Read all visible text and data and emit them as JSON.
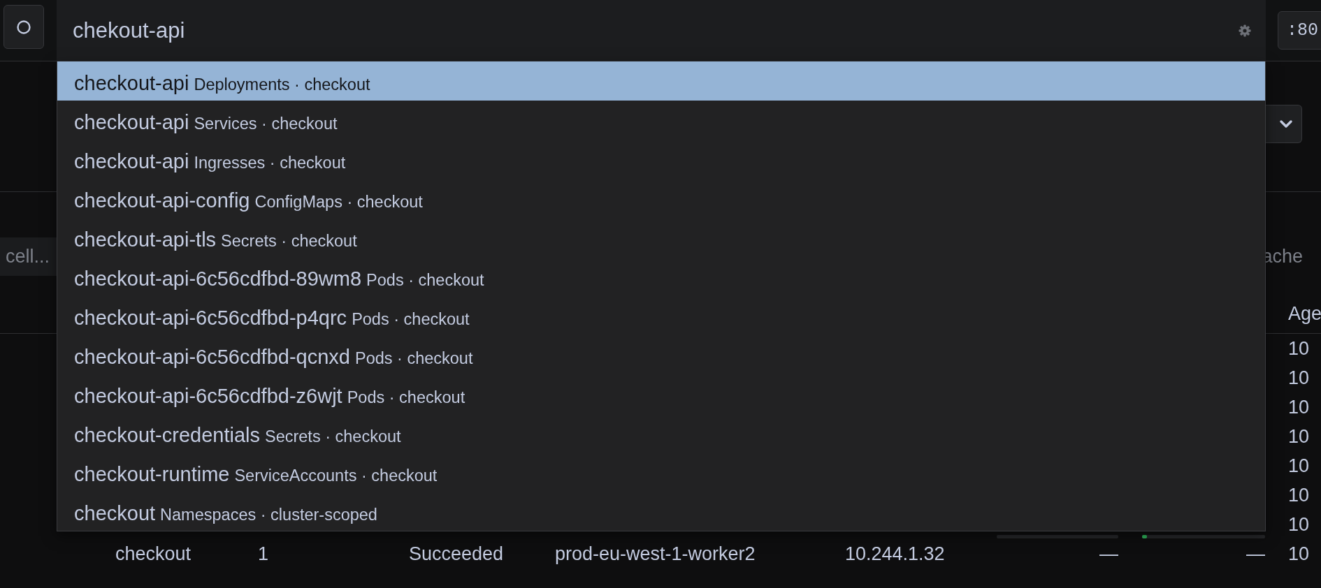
{
  "topbar": {
    "search": {
      "value": "chekout-api"
    },
    "port_button": ":80"
  },
  "results": [
    {
      "name": "checkout-api",
      "detail": "Deployments · checkout",
      "selected": true
    },
    {
      "name": "checkout-api",
      "detail": "Services · checkout",
      "selected": false
    },
    {
      "name": "checkout-api",
      "detail": "Ingresses · checkout",
      "selected": false
    },
    {
      "name": "checkout-api-config",
      "detail": "ConfigMaps · checkout",
      "selected": false
    },
    {
      "name": "checkout-api-tls",
      "detail": "Secrets · checkout",
      "selected": false
    },
    {
      "name": "checkout-api-6c56cdfbd-89wm8",
      "detail": "Pods · checkout",
      "selected": false
    },
    {
      "name": "checkout-api-6c56cdfbd-p4qrc",
      "detail": "Pods · checkout",
      "selected": false
    },
    {
      "name": "checkout-api-6c56cdfbd-qcnxd",
      "detail": "Pods · checkout",
      "selected": false
    },
    {
      "name": "checkout-api-6c56cdfbd-z6wjt",
      "detail": "Pods · checkout",
      "selected": false
    },
    {
      "name": "checkout-credentials",
      "detail": "Secrets · checkout",
      "selected": false
    },
    {
      "name": "checkout-runtime",
      "detail": "ServiceAccounts · checkout",
      "selected": false
    },
    {
      "name": "checkout",
      "detail": "Namespaces · cluster-scoped",
      "selected": false
    }
  ],
  "background": {
    "filter_field": {
      "placeholder": "cell..."
    },
    "right_text": "ache",
    "table": {
      "columns": [
        {
          "label": "Age"
        }
      ],
      "rows": [
        {
          "age": "10"
        },
        {
          "age": "10"
        },
        {
          "age": "10"
        },
        {
          "age": "10"
        },
        {
          "age": "10"
        },
        {
          "age": "10"
        },
        {
          "age": "10",
          "usage": [
            {
              "level": 0
            },
            {
              "level": 0.04
            }
          ]
        },
        {
          "column_1": "checkout",
          "column_2": "1",
          "column_3": "Succeeded",
          "column_4": "prod-eu-west-1-worker2",
          "column_5": "10.244.1.32",
          "column_6": "—",
          "column_7": "—",
          "age": "10"
        }
      ]
    }
  }
}
